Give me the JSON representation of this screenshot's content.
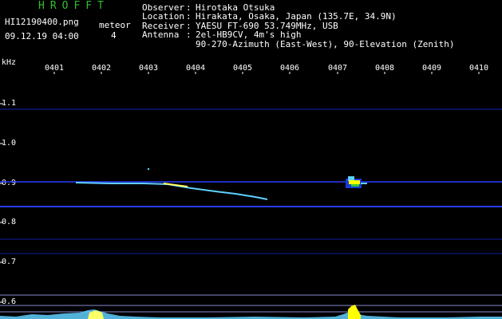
{
  "header": {
    "brand": "HROFFT",
    "filename": "HI12190400.png",
    "meteor_label": "meteor",
    "meteor_count": "4",
    "timestamp": "09.12.19 04:00"
  },
  "station_info": [
    {
      "key": "Observer",
      "value": "Hirotaka Otsuka"
    },
    {
      "key": "Location",
      "value": "Hirakata, Osaka, Japan (135.7E, 34.9N)"
    },
    {
      "key": "Receiver",
      "value": "YAESU FT-690 53.749MHz, USB"
    },
    {
      "key": "Antenna",
      "value": "2el-HB9CV, 4m's high"
    },
    {
      "key": "",
      "value": "90-270-Azimuth (East-West), 90-Elevation (Zenith)"
    }
  ],
  "separator": ":",
  "spectrogram": {
    "y_unit": "kHz",
    "x_ticks": [
      "0401",
      "0402",
      "0403",
      "0404",
      "0405",
      "0406",
      "0407",
      "0408",
      "0409",
      "0410"
    ],
    "y_ticks": [
      "1.1",
      "1.0",
      "0.9",
      "0.8",
      "0.7",
      "0.6"
    ],
    "ylim": [
      0.58,
      1.15
    ],
    "background": "#000000",
    "line_color": "#2a3cff",
    "echo_color": "#ffff00",
    "trace_color": "#5fd0ff"
  }
}
